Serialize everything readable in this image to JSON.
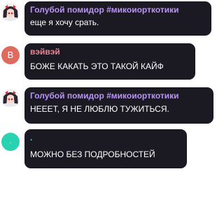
{
  "messages": [
    {
      "sender": "Голубой помидор #микоиорткотики",
      "text": "еще я хочу срать.",
      "avatar_icon": "anime-girl-avatar",
      "sender_color": "#b894f4"
    },
    {
      "sender": "вэйвэй",
      "text": "БОЖЕ КАКАТЬ ЭТО ТАКОЙ КАЙФ",
      "avatar_letter": "В",
      "avatar_color": "#e06a5e",
      "sender_color": "#e48796"
    },
    {
      "sender": "Голубой помидор #микоиорткотики",
      "text": "НЕЕЕТ, Я НЕ ЛЮБЛЮ ТУЖИТЬСЯ.",
      "avatar_icon": "anime-girl-avatar",
      "sender_color": "#b894f4"
    },
    {
      "sender": ".",
      "text": "МОЖНО БЕЗ ПОДРОБНОСТЕЙ",
      "avatar_letter": ".",
      "avatar_color": "#29d3b1",
      "sender_color": "#43d9bd"
    }
  ],
  "colors": {
    "bubble_bg": "#1b1a23",
    "message_text": "#ffffff"
  }
}
